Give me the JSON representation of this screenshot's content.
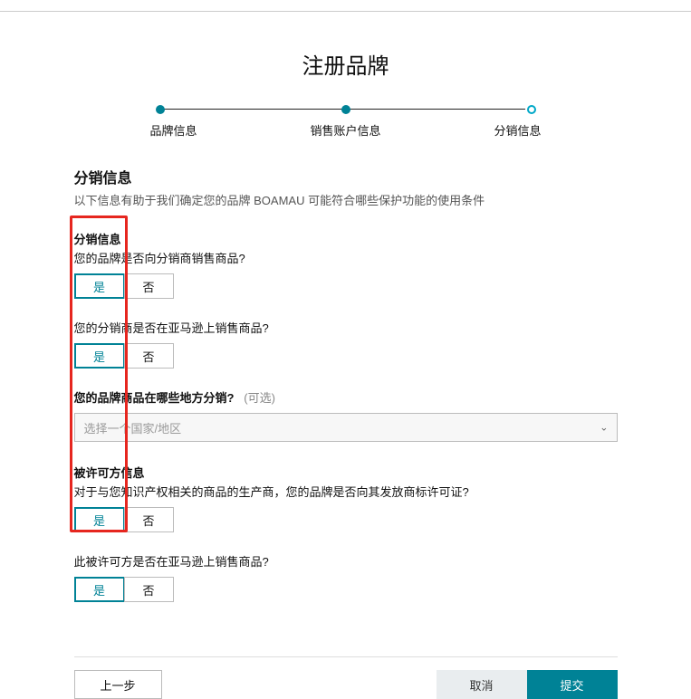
{
  "page_title": "注册品牌",
  "stepper": {
    "steps": [
      "品牌信息",
      "销售账户信息",
      "分销信息"
    ],
    "current_index": 2
  },
  "section": {
    "title": "分销信息",
    "subtitle": "以下信息有助于我们确定您的品牌 BOAMAU 可能符合哪些保护功能的使用条件"
  },
  "groups": {
    "dist": {
      "heading": "分销信息",
      "q1": "您的品牌是否向分销商销售商品?",
      "q2": "您的分销商是否在亚马逊上销售商品?",
      "q3_label": "您的品牌商品在哪些地方分销?",
      "q3_optional": "(可选)",
      "region_placeholder": "选择一个国家/地区"
    },
    "licensee": {
      "heading": "被许可方信息",
      "q1": "对于与您知识产权相关的商品的生产商，您的品牌是否向其发放商标许可证?",
      "q2": "此被许可方是否在亚马逊上销售商品?"
    }
  },
  "options": {
    "yes": "是",
    "no": "否"
  },
  "footer": {
    "prev": "上一步",
    "cancel": "取消",
    "submit": "提交"
  }
}
